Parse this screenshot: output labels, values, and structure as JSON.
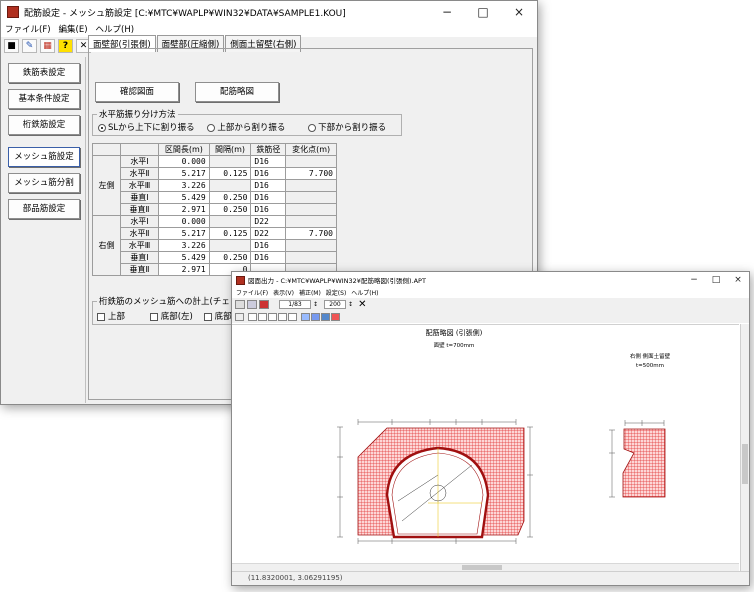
{
  "main": {
    "title": "配筋設定 - メッシュ筋設定  [C:¥MTC¥WAPLP¥WIN32¥DATA¥SAMPLE1.KOU]",
    "menu": [
      "ファイル(F)",
      "編集(E)",
      "ヘルプ(H)"
    ],
    "window_controls": [
      "−",
      "□",
      "×"
    ],
    "toolbar_icons": [
      "save-icon",
      "tool-icon",
      "tool2-icon",
      "help-icon",
      "close-icon"
    ],
    "toolbar_glyphs": [
      "■",
      "✎",
      "▦",
      "?",
      "✕"
    ],
    "sidebar": [
      "鉄筋表設定",
      "基本条件設定",
      "桁鉄筋設定",
      "メッシュ筋設定",
      "メッシュ筋分割",
      "部品筋設定"
    ],
    "tabs": [
      "面壁部(引張側)",
      "面壁部(圧縮側)",
      "側面土留壁(右側)"
    ],
    "buttons": {
      "confirm": "確認図面",
      "layout": "配筋略図"
    },
    "split_group": {
      "title": "水平筋振り分け方法",
      "options": [
        "SLから上下に割り振る",
        "上部から割り振る",
        "下部から割り振る"
      ]
    },
    "table": {
      "headers": [
        "区間長(m)",
        "間隔(m)",
        "鉄筋径",
        "変化点(m)"
      ],
      "sides": [
        "左側",
        "右側"
      ],
      "rows": [
        {
          "label": "水平Ⅰ",
          "len": "0.000",
          "pitch": "",
          "dia": "D16",
          "change": ""
        },
        {
          "label": "水平Ⅱ",
          "len": "5.217",
          "pitch": "0.125",
          "dia": "D16",
          "change": "7.700"
        },
        {
          "label": "水平Ⅲ",
          "len": "3.226",
          "pitch": "",
          "dia": "D16",
          "change": ""
        },
        {
          "label": "垂直Ⅰ",
          "len": "5.429",
          "pitch": "0.250",
          "dia": "D16",
          "change": ""
        },
        {
          "label": "垂直Ⅱ",
          "len": "2.971",
          "pitch": "0.250",
          "dia": "D16",
          "change": ""
        },
        {
          "label": "水平Ⅰ",
          "len": "0.000",
          "pitch": "",
          "dia": "D22",
          "change": ""
        },
        {
          "label": "水平Ⅱ",
          "len": "5.217",
          "pitch": "0.125",
          "dia": "D22",
          "change": "7.700"
        },
        {
          "label": "水平Ⅲ",
          "len": "3.226",
          "pitch": "",
          "dia": "D16",
          "change": ""
        },
        {
          "label": "垂直Ⅰ",
          "len": "5.429",
          "pitch": "0.250",
          "dia": "D16",
          "change": ""
        },
        {
          "label": "垂直Ⅱ",
          "len": "2.971",
          "pitch": "0",
          "dia": "",
          "change": ""
        }
      ]
    },
    "check_group": {
      "title": "桁鉄筋のメッシュ筋への計上(チェックを",
      "options": [
        "上部",
        "底部(左)",
        "底部"
      ]
    }
  },
  "drawing": {
    "title": "図面出力 - C:¥MTC¥WAPLP¥WIN32¥配筋略図(引張側).APT",
    "menu": [
      "ファイル(F)",
      "表示(V)",
      "補正(M)",
      "設定(S)",
      "ヘルプ(H)"
    ],
    "window_controls": [
      "−",
      "□",
      "×"
    ],
    "toolbar1": {
      "page": "1/83",
      "zoom": "200"
    },
    "toolbar1_icons": [
      "print-icon",
      "printer-setup-icon",
      "export-icon",
      "close-icon"
    ],
    "toolbar2_icons": [
      "page-icon",
      "zoom-fit-icon",
      "zoom-in-icon",
      "zoom-out-icon",
      "zoom-window-icon",
      "zoom-prev-icon",
      "layer1-icon",
      "layer2-icon",
      "layer3-icon",
      "layer4-icon"
    ],
    "sheet_title": "配筋略図 (引張側)",
    "front_label": "面壁  t=700mm",
    "side_label": "右側 側面土留壁",
    "side_thk": "t=500mm",
    "status": "(11.8320001, 3.06291195)",
    "colors": {
      "hatch": "#e03030",
      "fill": "#fdd6d6",
      "section": "#a01010"
    }
  }
}
